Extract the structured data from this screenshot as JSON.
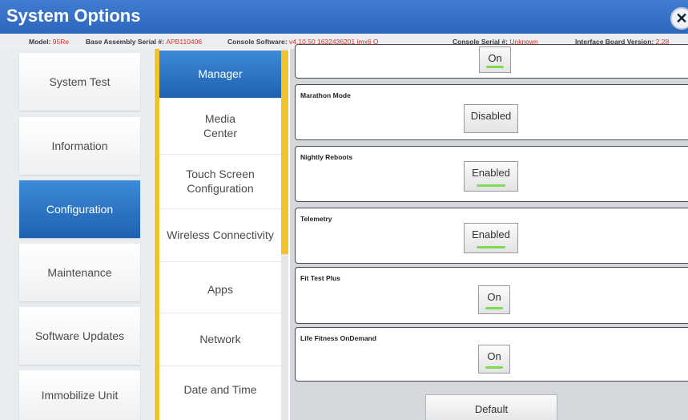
{
  "title": "System Options",
  "info": {
    "model_label": "Model:",
    "model_value": "95Re",
    "assembly_label": "Base Assembly Serial #:",
    "assembly_value": "APB110406",
    "software_label": "Console Software:",
    "software_value": "v4.10.50 1632436201 imx6 Q",
    "console_serial_label": "Console Serial #:",
    "console_serial_value": "Unknown",
    "interface_label": "Interface Board Version:",
    "interface_value": "2.28"
  },
  "left_menu": [
    {
      "label": "System Test",
      "active": false
    },
    {
      "label": "Information",
      "active": false
    },
    {
      "label": "Configuration",
      "active": true
    },
    {
      "label": "Maintenance",
      "active": false
    },
    {
      "label": "Software Updates",
      "active": false
    },
    {
      "label": "Immobilize Unit",
      "active": false
    }
  ],
  "sub_menu": [
    {
      "label": "Manager",
      "active": true
    },
    {
      "label": "Media\nCenter",
      "active": false
    },
    {
      "label": "Touch Screen\nConfiguration",
      "active": false
    },
    {
      "label": "Wireless Connectivity",
      "active": false
    },
    {
      "label": "Apps",
      "active": false
    },
    {
      "label": "Network",
      "active": false
    },
    {
      "label": "Date and Time",
      "active": false
    }
  ],
  "settings": [
    {
      "label": "",
      "value": "On",
      "indicator": "#7ed957"
    },
    {
      "label": "Marathon Mode",
      "value": "Disabled",
      "indicator": "#e6e6e6"
    },
    {
      "label": "Nightly Reboots",
      "value": "Enabled",
      "indicator": "#7ed957"
    },
    {
      "label": "Telemetry",
      "value": "Enabled",
      "indicator": "#7ed957"
    },
    {
      "label": "Fit Test Plus",
      "value": "On",
      "indicator": "#7ed957"
    },
    {
      "label": "Life Fitness OnDemand",
      "value": "On",
      "indicator": "#7ed957"
    }
  ],
  "default_label": "Default",
  "close_glyph": "✕",
  "colors": {
    "accent": "#2d67bd",
    "gold": "#f0c22c",
    "value_red": "#d8312a",
    "indicator_on": "#7ed957"
  }
}
